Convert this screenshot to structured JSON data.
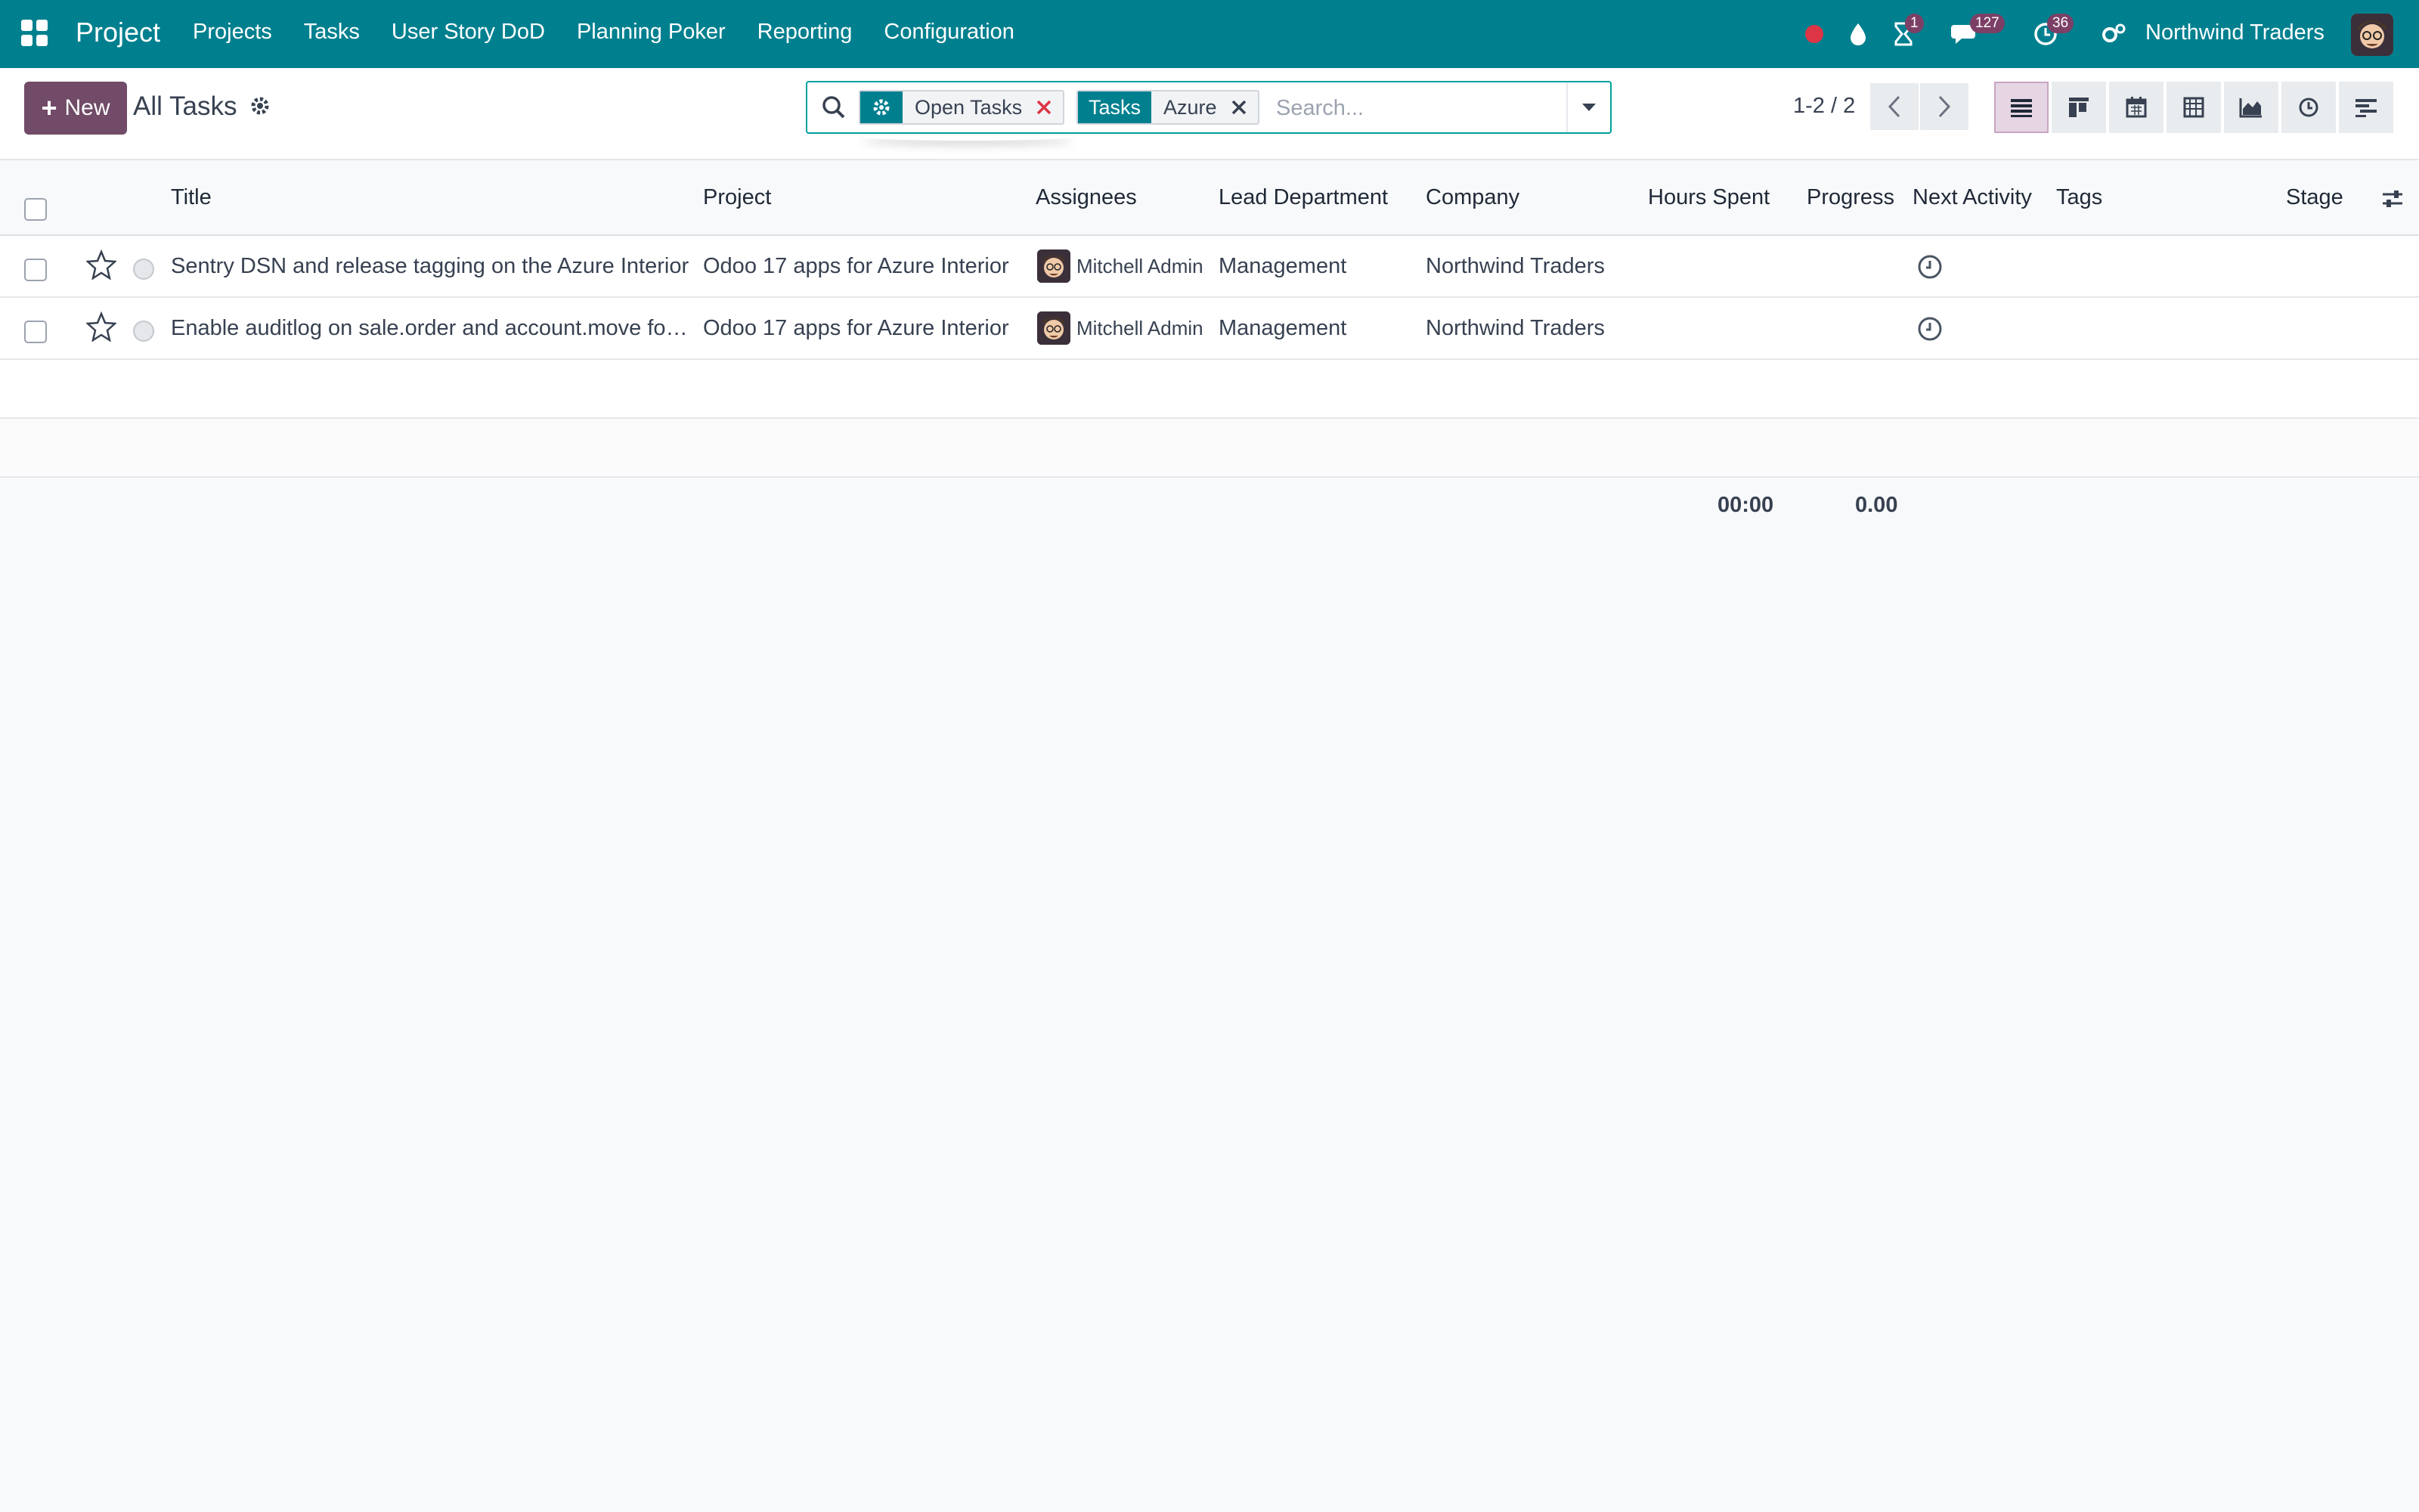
{
  "navbar": {
    "app_name": "Project",
    "menu": [
      "Projects",
      "Tasks",
      "User Story DoD",
      "Planning Poker",
      "Reporting",
      "Configuration"
    ],
    "badges": {
      "activities": "1",
      "messages": "127",
      "timer": "36"
    },
    "company": "Northwind Traders",
    "colors": {
      "navbar": "#00808f",
      "badge": "#7c3f66",
      "record_dot": "#dc3545"
    }
  },
  "control_panel": {
    "new_button": "New",
    "breadcrumb": "All Tasks",
    "search": {
      "facets": [
        {
          "label_icon": "gear-icon",
          "value": "Open Tasks"
        },
        {
          "label": "Tasks",
          "value": "Azure"
        }
      ],
      "placeholder": "Search..."
    },
    "pager": "1-2 / 2",
    "views": [
      "list-view-icon",
      "kanban-view-icon",
      "calendar-view-icon",
      "pivot-view-icon",
      "graph-view-icon",
      "activity-view-icon",
      "gantt-view-icon"
    ]
  },
  "table": {
    "columns": [
      "Title",
      "Project",
      "Assignees",
      "Lead Department",
      "Company",
      "Hours Spent",
      "Progress",
      "Next Activity",
      "Tags",
      "Stage"
    ],
    "rows": [
      {
        "title": "Sentry DSN and release tagging on the Azure Interior",
        "project": "Odoo 17 apps for Azure Interior",
        "assignee": "Mitchell Admin",
        "department": "Management",
        "company": "Northwind Traders"
      },
      {
        "title": "Enable auditlog on sale.order and account.move for Azure Interior",
        "project": "Odoo 17 apps for Azure Interior",
        "assignee": "Mitchell Admin",
        "department": "Management",
        "company": "Northwind Traders"
      }
    ],
    "totals": {
      "hours_spent": "00:00",
      "progress": "0.00"
    }
  }
}
